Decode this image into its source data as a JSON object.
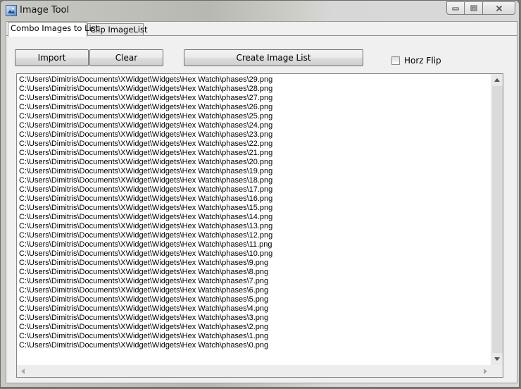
{
  "window": {
    "title": "Image Tool",
    "icon": "image-tool-icon",
    "controls": {
      "minimize": "▭",
      "maximize": "◻",
      "close": "✕"
    }
  },
  "tabs": [
    {
      "label": "Combo Images to List",
      "active": true
    },
    {
      "label": "Clip ImageList",
      "active": false
    }
  ],
  "toolbar": {
    "import_label": "Import",
    "clear_label": "Clear",
    "create_label": "Create Image List",
    "horz_flip_label": "Horz Flip",
    "horz_flip_checked": false
  },
  "list": {
    "items": [
      "C:\\Users\\Dimitris\\Documents\\XWidget\\Widgets\\Hex Watch\\phases\\29.png",
      "C:\\Users\\Dimitris\\Documents\\XWidget\\Widgets\\Hex Watch\\phases\\28.png",
      "C:\\Users\\Dimitris\\Documents\\XWidget\\Widgets\\Hex Watch\\phases\\27.png",
      "C:\\Users\\Dimitris\\Documents\\XWidget\\Widgets\\Hex Watch\\phases\\26.png",
      "C:\\Users\\Dimitris\\Documents\\XWidget\\Widgets\\Hex Watch\\phases\\25.png",
      "C:\\Users\\Dimitris\\Documents\\XWidget\\Widgets\\Hex Watch\\phases\\24.png",
      "C:\\Users\\Dimitris\\Documents\\XWidget\\Widgets\\Hex Watch\\phases\\23.png",
      "C:\\Users\\Dimitris\\Documents\\XWidget\\Widgets\\Hex Watch\\phases\\22.png",
      "C:\\Users\\Dimitris\\Documents\\XWidget\\Widgets\\Hex Watch\\phases\\21.png",
      "C:\\Users\\Dimitris\\Documents\\XWidget\\Widgets\\Hex Watch\\phases\\20.png",
      "C:\\Users\\Dimitris\\Documents\\XWidget\\Widgets\\Hex Watch\\phases\\19.png",
      "C:\\Users\\Dimitris\\Documents\\XWidget\\Widgets\\Hex Watch\\phases\\18.png",
      "C:\\Users\\Dimitris\\Documents\\XWidget\\Widgets\\Hex Watch\\phases\\17.png",
      "C:\\Users\\Dimitris\\Documents\\XWidget\\Widgets\\Hex Watch\\phases\\16.png",
      "C:\\Users\\Dimitris\\Documents\\XWidget\\Widgets\\Hex Watch\\phases\\15.png",
      "C:\\Users\\Dimitris\\Documents\\XWidget\\Widgets\\Hex Watch\\phases\\14.png",
      "C:\\Users\\Dimitris\\Documents\\XWidget\\Widgets\\Hex Watch\\phases\\13.png",
      "C:\\Users\\Dimitris\\Documents\\XWidget\\Widgets\\Hex Watch\\phases\\12.png",
      "C:\\Users\\Dimitris\\Documents\\XWidget\\Widgets\\Hex Watch\\phases\\11.png",
      "C:\\Users\\Dimitris\\Documents\\XWidget\\Widgets\\Hex Watch\\phases\\10.png",
      "C:\\Users\\Dimitris\\Documents\\XWidget\\Widgets\\Hex Watch\\phases\\9.png",
      "C:\\Users\\Dimitris\\Documents\\XWidget\\Widgets\\Hex Watch\\phases\\8.png",
      "C:\\Users\\Dimitris\\Documents\\XWidget\\Widgets\\Hex Watch\\phases\\7.png",
      "C:\\Users\\Dimitris\\Documents\\XWidget\\Widgets\\Hex Watch\\phases\\6.png",
      "C:\\Users\\Dimitris\\Documents\\XWidget\\Widgets\\Hex Watch\\phases\\5.png",
      "C:\\Users\\Dimitris\\Documents\\XWidget\\Widgets\\Hex Watch\\phases\\4.png",
      "C:\\Users\\Dimitris\\Documents\\XWidget\\Widgets\\Hex Watch\\phases\\3.png",
      "C:\\Users\\Dimitris\\Documents\\XWidget\\Widgets\\Hex Watch\\phases\\2.png",
      "C:\\Users\\Dimitris\\Documents\\XWidget\\Widgets\\Hex Watch\\phases\\1.png",
      "C:\\Users\\Dimitris\\Documents\\XWidget\\Widgets\\Hex Watch\\phases\\0.png"
    ]
  },
  "scrollbars": {
    "up_icon": "chevron-up-icon",
    "down_icon": "chevron-down-icon",
    "left_icon": "chevron-left-icon",
    "right_icon": "chevron-right-icon"
  }
}
